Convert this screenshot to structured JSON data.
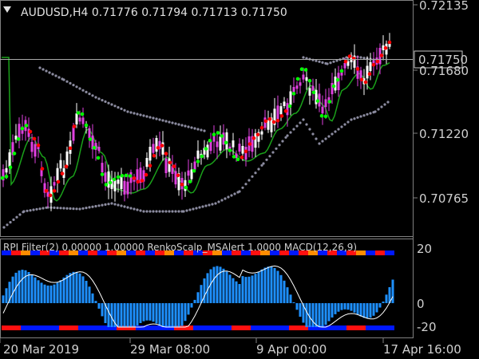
{
  "main_chart": {
    "symbol_line": "AUDUSD,H4  0.71776 0.71794 0.71713 0.71750",
    "current_price_label": "0.71750",
    "price_ticks": [
      "0.72135",
      "0.71680",
      "0.71220",
      "0.70765"
    ],
    "ylim": [
      0.7058,
      0.7224
    ],
    "colors": {
      "background": "#000000",
      "bull_candle": "#ffffff",
      "bear_candle": "#e040e0",
      "signal_up": "#00ff00",
      "signal_down": "#ff0000",
      "ma": "#1aa01a",
      "band_dots": "#8c8ca0",
      "price_line": "#a8a8a8"
    },
    "icons": [
      "price-line-marker"
    ]
  },
  "indicator_pane": {
    "header": "RPI Filter(2) 0.00000 1.00000  RenkoScalp_MSAlert 1.0000  MACD(12,26,9)",
    "scale_ticks": [
      "20",
      "0",
      "-20"
    ],
    "colors": {
      "histogram": "#1e90ff",
      "signal_line": "#ffffff",
      "bar_blue": "#0018ff",
      "bar_red": "#ff1010",
      "bar_orange": "#ff8c00"
    }
  },
  "time_axis": {
    "labels": [
      "20 Mar 2019",
      "29 Mar 08:00",
      "9 Apr 00:00",
      "17 Apr 16:00"
    ]
  }
}
